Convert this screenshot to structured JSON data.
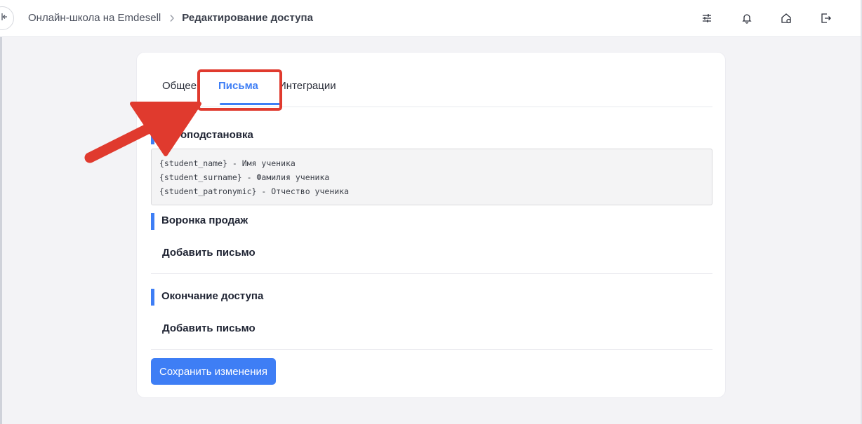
{
  "header": {
    "breadcrumb_root": "Онлайн-школа на Emdesell",
    "breadcrumb_current": "Редактирование доступа",
    "icons": [
      "collapse-sidebar-icon",
      "sliders-icon",
      "bell-icon",
      "home-settings-icon",
      "logout-icon"
    ]
  },
  "tabs": [
    {
      "label": "Общее"
    },
    {
      "label": "Письма",
      "active": true
    },
    {
      "label": "Интеграции"
    }
  ],
  "sections": {
    "autosubstitution": {
      "title": "Автоподстановка",
      "lines": [
        "{student_name} - Имя ученика",
        "{student_surname} - Фамилия ученика",
        "{student_patronymic} - Отчество ученика"
      ]
    },
    "sales_funnel": {
      "title": "Воронка продаж",
      "add_label": "Добавить письмо"
    },
    "access_end": {
      "title": "Окончание доступа",
      "add_label": "Добавить письмо"
    }
  },
  "save_label": "Сохранить изменения",
  "colors": {
    "accent": "#3e7ef5",
    "annotation": "#e03a2e",
    "background": "#f3f3f6"
  }
}
